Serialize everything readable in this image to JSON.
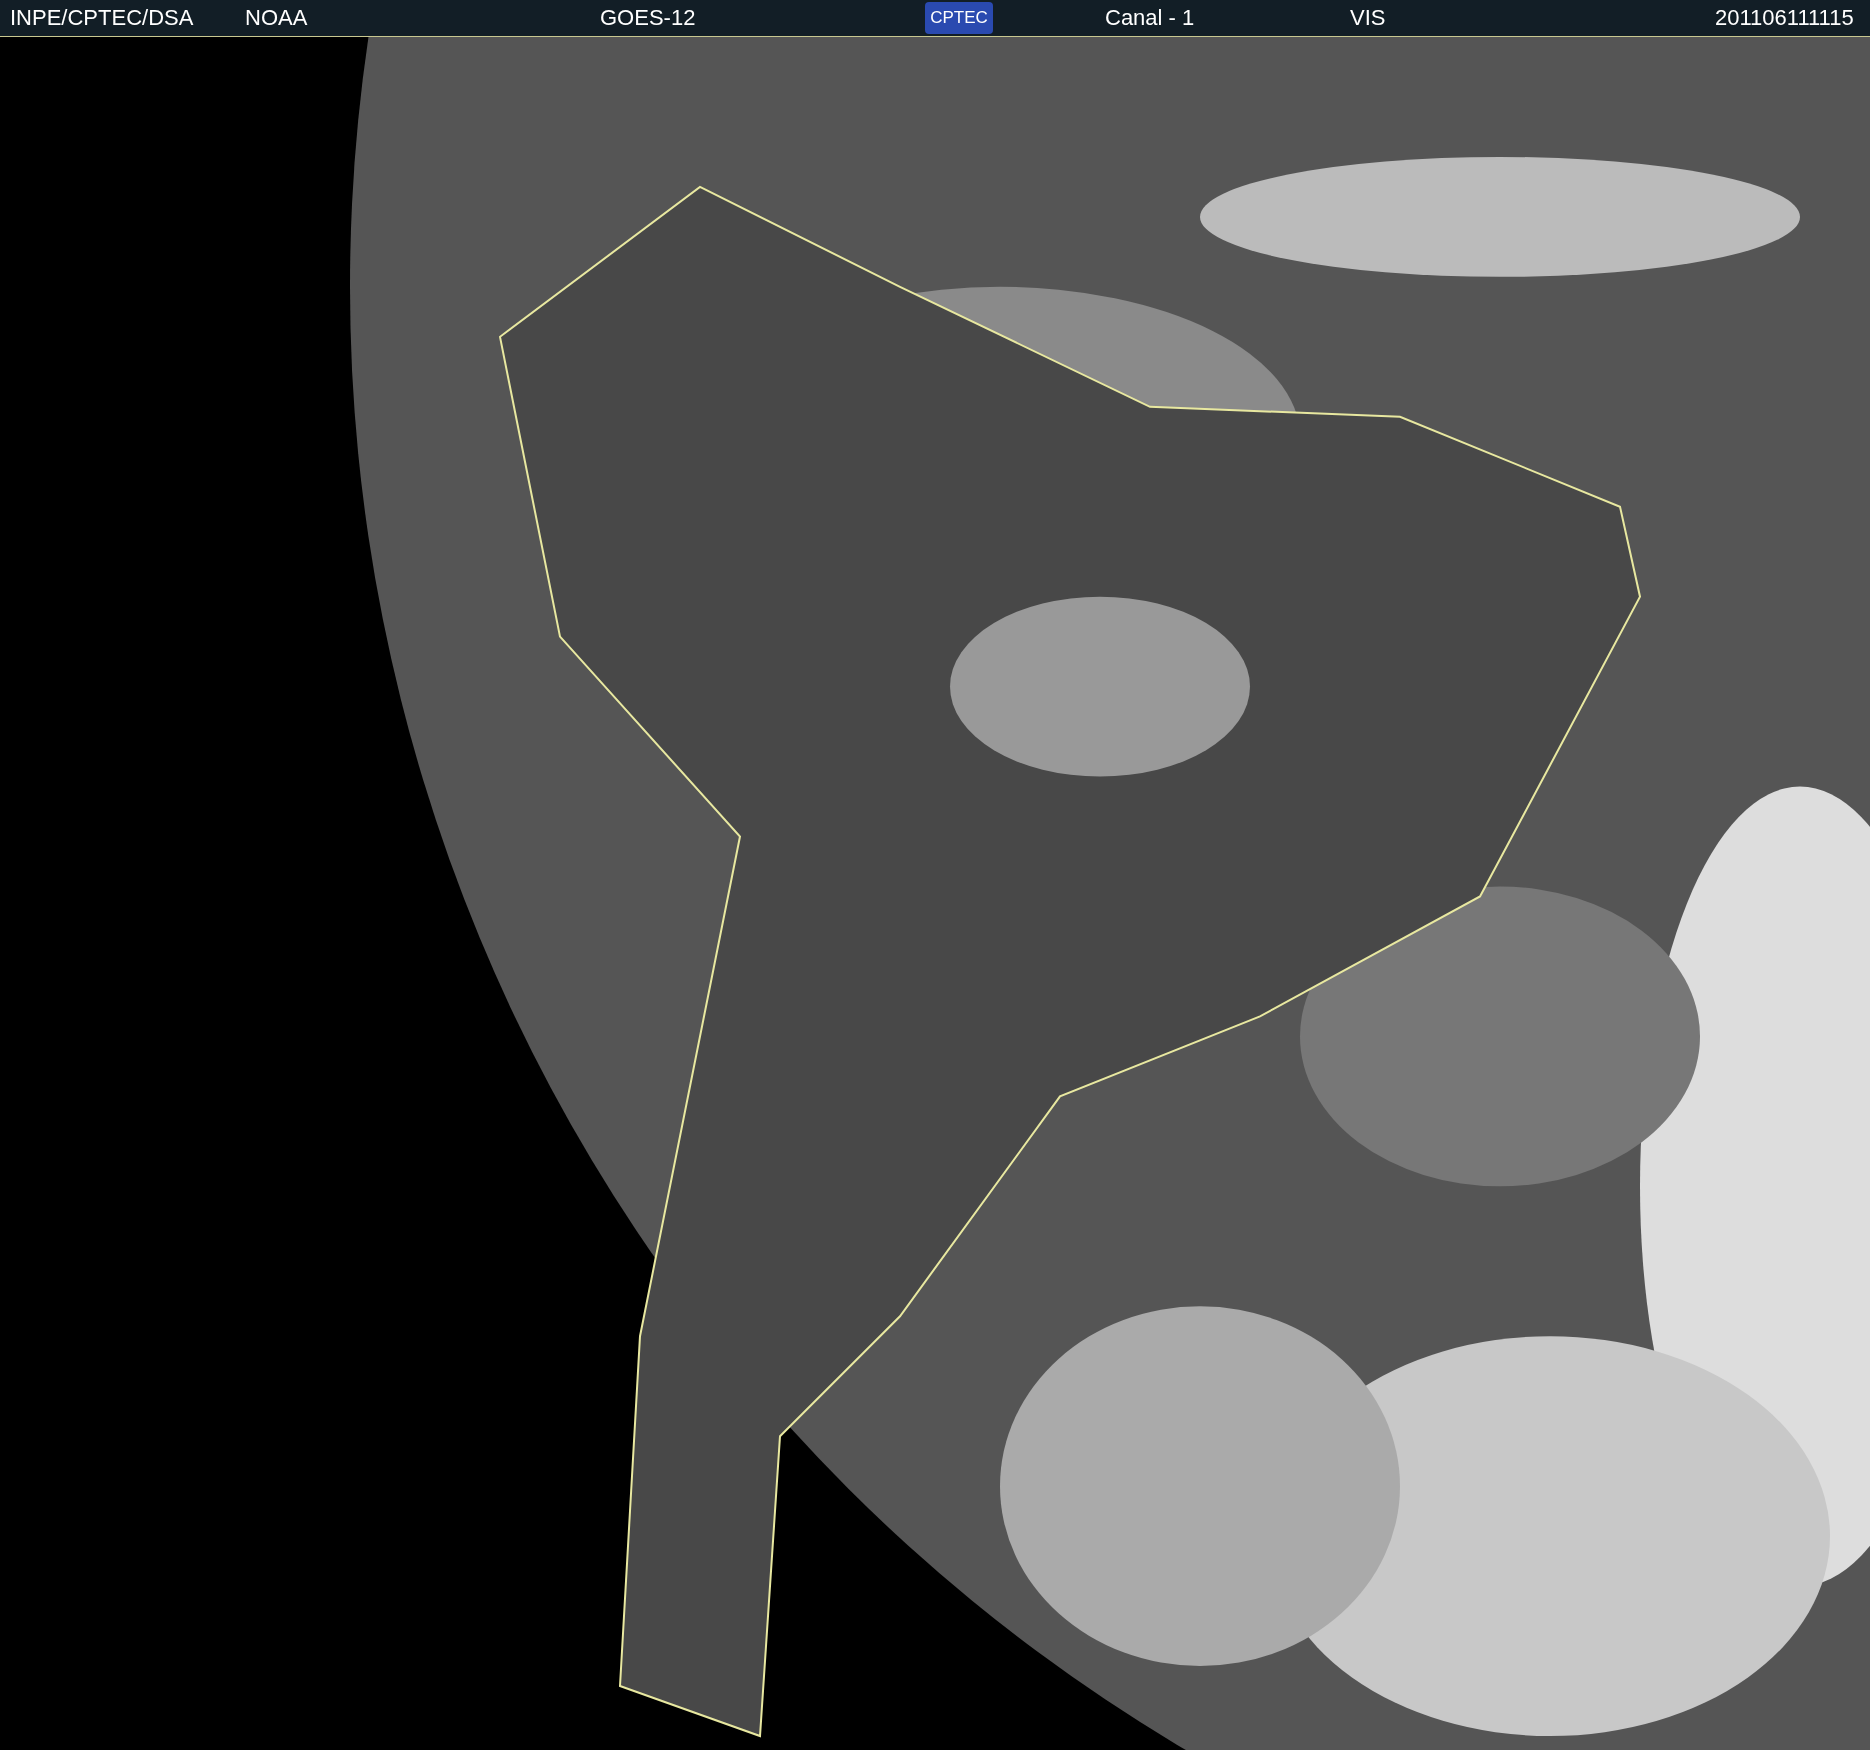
{
  "header": {
    "source": "INPE/CPTEC/DSA",
    "agency": "NOAA",
    "satellite": "GOES-12",
    "logo": "CPTEC",
    "channel": "Canal - 1",
    "band": "VIS",
    "timestamp": "201106111115"
  }
}
